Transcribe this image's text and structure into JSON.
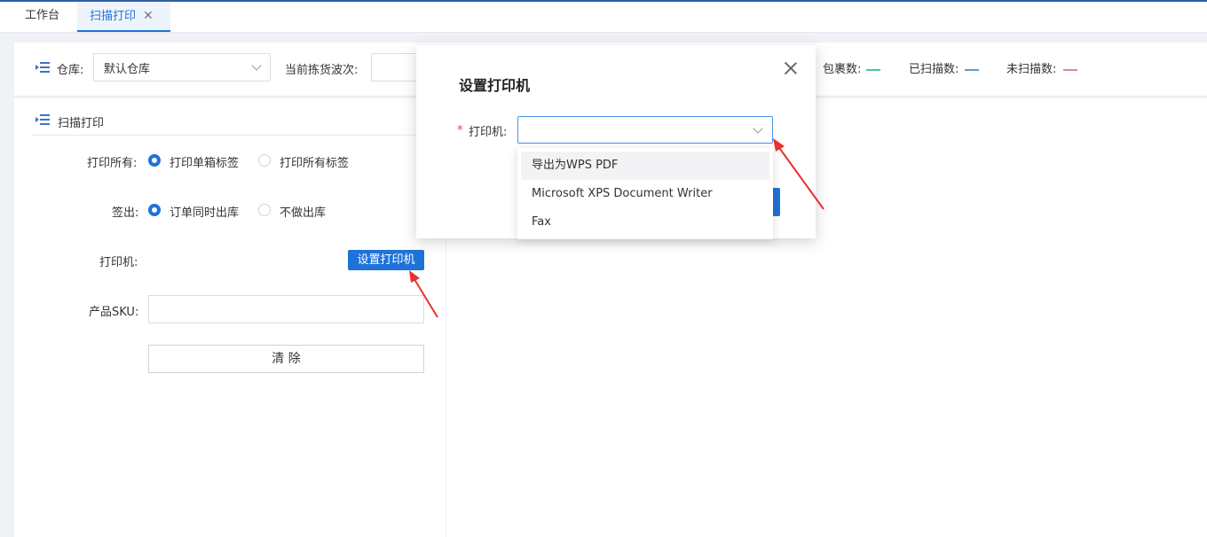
{
  "tabs": [
    {
      "label": "工作台"
    },
    {
      "label": "扫描打印",
      "close": "✕"
    }
  ],
  "filter": {
    "warehouse_label": "仓库:",
    "warehouse_value": "默认仓库",
    "wave_label": "当前拣货波次:",
    "stat_packages": "包裹数:",
    "stat_scanned": "已扫描数:",
    "stat_unscanned": "未扫描数:"
  },
  "scan_panel": {
    "title": "扫描打印",
    "print_all_label": "打印所有:",
    "print_single": "打印单箱标签",
    "print_all_tags": "打印所有标签",
    "checkout_label": "签出:",
    "checkout_same": "订单同时出库",
    "checkout_none": "不做出库",
    "printer_label": "打印机:",
    "set_printer_btn": "设置打印机",
    "sku_label": "产品SKU:",
    "clear_btn": "清 除"
  },
  "modal": {
    "title": "设置打印机",
    "required_mark": "*",
    "printer_field_label": "打印机:",
    "options": [
      "导出为WPS PDF",
      "Microsoft XPS Document Writer",
      "Fax"
    ]
  },
  "colors": {
    "accent": "#1f72d8",
    "stat_green": "#52c49a",
    "stat_blue": "#5b9bd5",
    "stat_red": "#e5848a",
    "arrow_red": "#e8322b"
  }
}
